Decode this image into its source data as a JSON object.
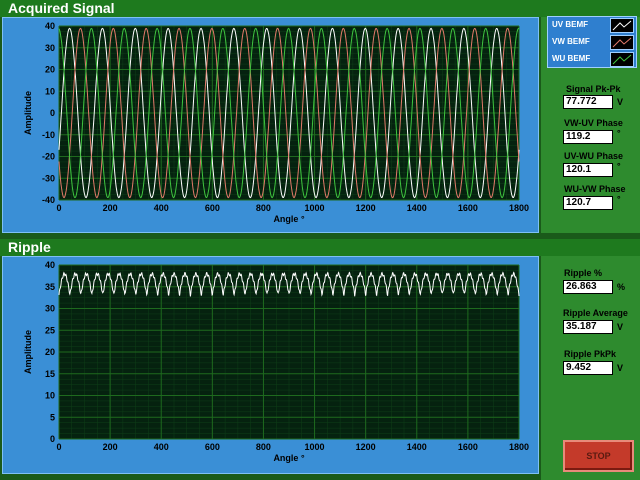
{
  "colors": {
    "plot_bg": "#05220f",
    "grid": "#1e6a1e",
    "trace_uv": "#ffffff",
    "trace_vw": "#e27a6a",
    "trace_wu": "#3fc43f",
    "ripple_trace": "#ffffff",
    "frame": "#3a8fd6"
  },
  "acquired": {
    "title": "Acquired Signal",
    "xlabel": "Angle °",
    "ylabel": "Amplitude",
    "x_ticks": [
      "0",
      "200",
      "400",
      "600",
      "800",
      "1000",
      "1200",
      "1400",
      "1600",
      "1800"
    ],
    "y_ticks": [
      "40",
      "30",
      "20",
      "10",
      "0",
      "-10",
      "-20",
      "-30",
      "-40"
    ]
  },
  "ripple": {
    "title": "Ripple",
    "xlabel": "Angle °",
    "ylabel": "Amplitude",
    "x_ticks": [
      "0",
      "200",
      "400",
      "600",
      "800",
      "1000",
      "1200",
      "1400",
      "1600",
      "1800"
    ],
    "y_ticks": [
      "40",
      "35",
      "30",
      "25",
      "20",
      "15",
      "10",
      "5",
      "0"
    ]
  },
  "legend": [
    {
      "label": "UV BEMF",
      "color": "#ffffff"
    },
    {
      "label": "VW BEMF",
      "color": "#e27a6a"
    },
    {
      "label": "WU BEMF",
      "color": "#3fc43f"
    }
  ],
  "indicators_top": {
    "signal_pkpk_label": "Signal Pk-Pk",
    "signal_pkpk_value": "77.772",
    "signal_pkpk_unit": "V",
    "vw_uv_label": "VW-UV Phase",
    "vw_uv_value": "119.2",
    "vw_uv_unit": "°",
    "uv_wu_label": "UV-WU Phase",
    "uv_wu_value": "120.1",
    "uv_wu_unit": "°",
    "wu_vw_label": "WU-VW Phase",
    "wu_vw_value": "120.7",
    "wu_vw_unit": "°"
  },
  "indicators_bottom": {
    "ripple_pct_label": "Ripple %",
    "ripple_pct_value": "26.863",
    "ripple_pct_unit": "%",
    "ripple_avg_label": "Ripple Average",
    "ripple_avg_value": "35.187",
    "ripple_avg_unit": "V",
    "ripple_pkpk_label": "Ripple PkPk",
    "ripple_pkpk_value": "9.452",
    "ripple_pkpk_unit": "V"
  },
  "stop_label": "STOP",
  "chart_data": [
    {
      "type": "line",
      "title": "Acquired Signal",
      "xlabel": "Angle °",
      "ylabel": "Amplitude",
      "xlim": [
        0,
        1800
      ],
      "ylim": [
        -40,
        40
      ],
      "grid": true,
      "legend": "top-right",
      "series": [
        {
          "name": "UV BEMF",
          "amplitude": 38.9,
          "cycles": 14,
          "phase_deg": 0
        },
        {
          "name": "VW BEMF",
          "amplitude": 38.9,
          "cycles": 14,
          "phase_deg": 119.2
        },
        {
          "name": "WU BEMF",
          "amplitude": 38.9,
          "cycles": 14,
          "phase_deg": 239.3
        }
      ]
    },
    {
      "type": "line",
      "title": "Ripple",
      "xlabel": "Angle °",
      "ylabel": "Amplitude",
      "xlim": [
        0,
        1800
      ],
      "ylim": [
        0,
        40
      ],
      "grid": true,
      "series": [
        {
          "name": "",
          "mean": 35.2,
          "min": 31,
          "max": 38.5,
          "cycles": 42
        }
      ]
    }
  ]
}
